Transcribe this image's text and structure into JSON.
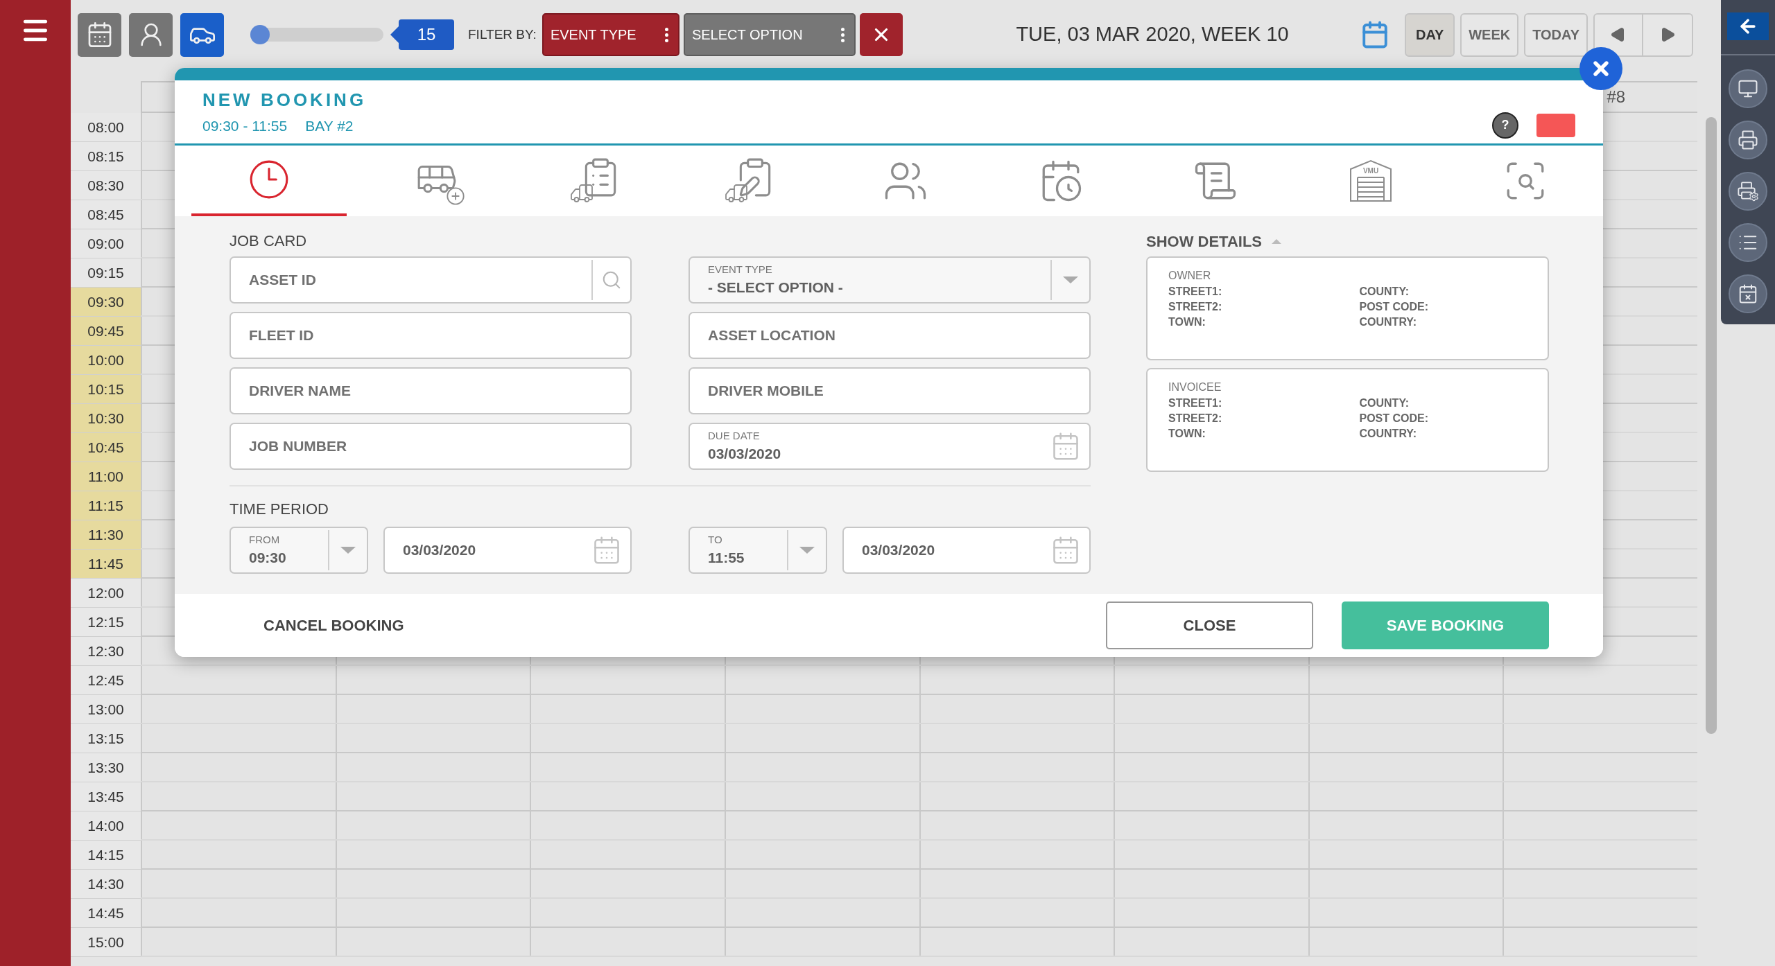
{
  "topbar": {
    "modes": [
      {
        "kind": "calendar",
        "selected": false
      },
      {
        "kind": "mechanic",
        "selected": false
      },
      {
        "kind": "car-lift",
        "selected": true
      }
    ],
    "slider": {
      "level": 0,
      "value": "15"
    },
    "filter_label": "FILTER BY:",
    "filters": [
      {
        "label": "EVENT TYPE",
        "active": true
      },
      {
        "label": "SELECT OPTION",
        "active": false
      }
    ],
    "date_title": "TUE, 03 MAR 2020, WEEK 10",
    "views": [
      {
        "label": "DAY",
        "selected": true
      },
      {
        "label": "WEEK",
        "selected": false
      },
      {
        "label": "TODAY",
        "selected": false
      }
    ]
  },
  "calendar": {
    "visible_bay": "#8",
    "slots": [
      {
        "time": "08:00",
        "selected": false
      },
      {
        "time": "08:15",
        "selected": false
      },
      {
        "time": "08:30",
        "selected": false
      },
      {
        "time": "08:45",
        "selected": false
      },
      {
        "time": "09:00",
        "selected": false
      },
      {
        "time": "09:15",
        "selected": false
      },
      {
        "time": "09:30",
        "selected": true
      },
      {
        "time": "09:45",
        "selected": true
      },
      {
        "time": "10:00",
        "selected": true
      },
      {
        "time": "10:15",
        "selected": true
      },
      {
        "time": "10:30",
        "selected": true
      },
      {
        "time": "10:45",
        "selected": true
      },
      {
        "time": "11:00",
        "selected": true
      },
      {
        "time": "11:15",
        "selected": true
      },
      {
        "time": "11:30",
        "selected": true
      },
      {
        "time": "11:45",
        "selected": true
      },
      {
        "time": "12:00",
        "selected": false
      },
      {
        "time": "12:15",
        "selected": false
      },
      {
        "time": "12:30",
        "selected": false
      },
      {
        "time": "12:45",
        "selected": false
      },
      {
        "time": "13:00",
        "selected": false
      },
      {
        "time": "13:15",
        "selected": false
      },
      {
        "time": "13:30",
        "selected": false
      },
      {
        "time": "13:45",
        "selected": false
      },
      {
        "time": "14:00",
        "selected": false
      },
      {
        "time": "14:15",
        "selected": false
      },
      {
        "time": "14:30",
        "selected": false
      },
      {
        "time": "14:45",
        "selected": false
      },
      {
        "time": "15:00",
        "selected": false
      }
    ]
  },
  "modal": {
    "title": "NEW BOOKING",
    "time": "09:30 - 11:55",
    "bay": "BAY #2",
    "help": "?",
    "tabs": [
      {
        "kind": "clock",
        "selected": true
      },
      {
        "kind": "bus-add",
        "selected": false
      },
      {
        "kind": "checklist",
        "selected": false
      },
      {
        "kind": "clipboard-edit",
        "selected": false
      },
      {
        "kind": "team",
        "selected": false
      },
      {
        "kind": "schedule",
        "selected": false
      },
      {
        "kind": "list",
        "selected": false
      },
      {
        "kind": "garage",
        "label": "VMU",
        "selected": false
      },
      {
        "kind": "search",
        "selected": false
      }
    ],
    "job_card": {
      "title": "JOB CARD",
      "left": [
        {
          "kind": "search",
          "placeholder": "ASSET ID"
        },
        {
          "kind": "text",
          "placeholder": "FLEET ID"
        },
        {
          "kind": "text",
          "placeholder": "DRIVER NAME"
        },
        {
          "kind": "text",
          "placeholder": "JOB NUMBER"
        }
      ],
      "right": [
        {
          "kind": "select",
          "label": "EVENT TYPE",
          "value": "- SELECT OPTION -"
        },
        {
          "kind": "text",
          "placeholder": "ASSET LOCATION"
        },
        {
          "kind": "text",
          "placeholder": "DRIVER MOBILE"
        },
        {
          "kind": "date",
          "label": "DUE DATE",
          "value": "03/03/2020"
        }
      ]
    },
    "time_period": {
      "title": "TIME PERIOD",
      "from": {
        "label": "FROM",
        "time": "09:30",
        "date": "03/03/2020"
      },
      "to": {
        "label": "TO",
        "time": "11:55",
        "date": "03/03/2020"
      }
    },
    "details": {
      "title": "SHOW DETAILS",
      "expanded": true,
      "cards": [
        {
          "title": "OWNER",
          "left": [
            "STREET1:",
            "STREET2:",
            "TOWN:"
          ],
          "right": [
            "COUNTY:",
            "POST CODE:",
            "COUNTRY:"
          ]
        },
        {
          "title": "INVOICEE",
          "left": [
            "STREET1:",
            "STREET2:",
            "TOWN:"
          ],
          "right": [
            "COUNTY:",
            "POST CODE:",
            "COUNTRY:"
          ]
        }
      ]
    },
    "cancel": "CANCEL BOOKING",
    "close": "CLOSE",
    "save": "SAVE BOOKING"
  }
}
